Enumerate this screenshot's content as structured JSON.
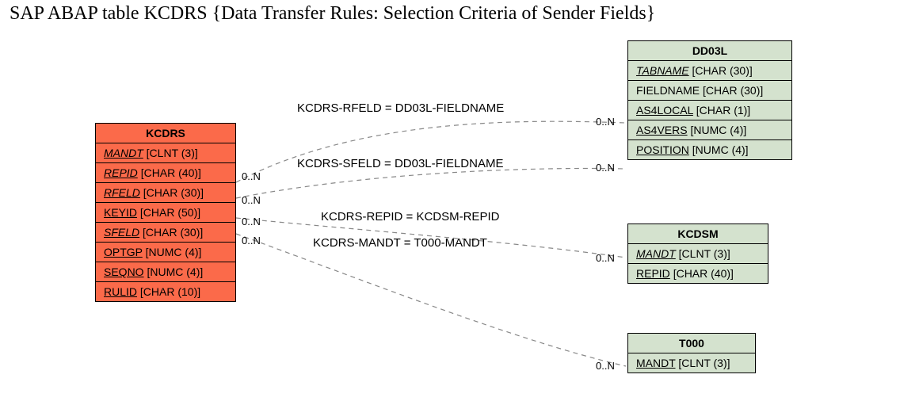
{
  "title": "SAP ABAP table KCDRS {Data Transfer Rules: Selection Criteria of Sender Fields}",
  "tables": {
    "kcdrs": {
      "name": "KCDRS",
      "fields": [
        {
          "name": "MANDT",
          "type": "[CLNT (3)]",
          "ul": true,
          "it": true
        },
        {
          "name": "REPID",
          "type": "[CHAR (40)]",
          "ul": true,
          "it": true
        },
        {
          "name": "RFELD",
          "type": "[CHAR (30)]",
          "ul": true,
          "it": true
        },
        {
          "name": "KEYID",
          "type": "[CHAR (50)]",
          "ul": true,
          "it": false
        },
        {
          "name": "SFELD",
          "type": "[CHAR (30)]",
          "ul": true,
          "it": true
        },
        {
          "name": "OPTGP",
          "type": "[NUMC (4)]",
          "ul": true,
          "it": false
        },
        {
          "name": "SEQNO",
          "type": "[NUMC (4)]",
          "ul": true,
          "it": false
        },
        {
          "name": "RULID",
          "type": "[CHAR (10)]",
          "ul": true,
          "it": false
        }
      ]
    },
    "dd03l": {
      "name": "DD03L",
      "fields": [
        {
          "name": "TABNAME",
          "type": "[CHAR (30)]",
          "ul": true,
          "it": true
        },
        {
          "name": "FIELDNAME",
          "type": "[CHAR (30)]",
          "ul": false,
          "it": false
        },
        {
          "name": "AS4LOCAL",
          "type": "[CHAR (1)]",
          "ul": true,
          "it": false
        },
        {
          "name": "AS4VERS",
          "type": "[NUMC (4)]",
          "ul": true,
          "it": false
        },
        {
          "name": "POSITION",
          "type": "[NUMC (4)]",
          "ul": true,
          "it": false
        }
      ]
    },
    "kcdsm": {
      "name": "KCDSM",
      "fields": [
        {
          "name": "MANDT",
          "type": "[CLNT (3)]",
          "ul": true,
          "it": true
        },
        {
          "name": "REPID",
          "type": "[CHAR (40)]",
          "ul": true,
          "it": false
        }
      ]
    },
    "t000": {
      "name": "T000",
      "fields": [
        {
          "name": "MANDT",
          "type": "[CLNT (3)]",
          "ul": true,
          "it": false
        }
      ]
    }
  },
  "relations": {
    "r1": "KCDRS-RFELD = DD03L-FIELDNAME",
    "r2": "KCDRS-SFELD = DD03L-FIELDNAME",
    "r3": "KCDRS-REPID = KCDSM-REPID",
    "r4": "KCDRS-MANDT = T000-MANDT"
  },
  "card": {
    "c1l": "0..N",
    "c1r": "0..N",
    "c2l": "0..N",
    "c2r": "0..N",
    "c3l": "0..N",
    "c3r": "0..N",
    "c4l": "0..N",
    "c4r": "0..N"
  }
}
